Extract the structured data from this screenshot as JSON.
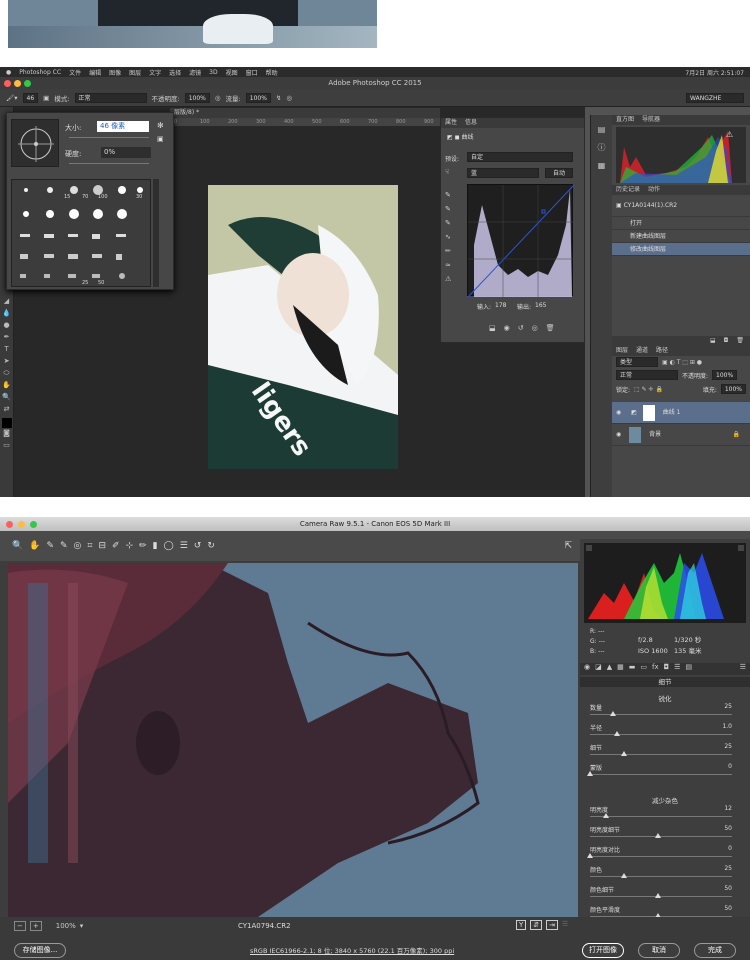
{
  "top_photo": {},
  "mac_menu": [
    "Photoshop CC",
    "文件",
    "编辑",
    "图像",
    "图层",
    "文字",
    "选择",
    "滤镜",
    "3D",
    "视图",
    "窗口",
    "帮助"
  ],
  "mac_status": "7月2日 周六 2:51:07",
  "ps": {
    "title": "Adobe Photoshop CC 2015",
    "options": {
      "brush_size_value": "46",
      "mode_label": "模式:",
      "mode_value": "正常",
      "opacity_label": "不透明度:",
      "opacity_value": "100%",
      "flow_label": "流量:",
      "flow_value": "100%",
      "workspace": "WANGZHE"
    },
    "brush_panel": {
      "size_label": "大小:",
      "size_value": "46 像素",
      "hardness_label": "硬度:",
      "hardness_value": "0%",
      "preset_numbers_row1": [
        "15",
        "70",
        "100",
        "30"
      ],
      "preset_numbers_row2": [
        "25",
        "50"
      ]
    },
    "document_tab": "层版/8) *",
    "ruler_marks": [
      "0",
      "100",
      "200",
      "300",
      "400",
      "500",
      "600",
      "700",
      "800",
      "900"
    ],
    "curves_panel": {
      "tab_properties": "属性",
      "tab_info": "信息",
      "panel_name": "曲线",
      "preset_label": "预设:",
      "preset_value": "自定",
      "channel_value": "蓝",
      "auto_button": "自动",
      "input_label": "输入:",
      "input_value": "178",
      "output_label": "输出:",
      "output_value": "165"
    },
    "histogram_panel": {
      "tab_histogram": "直方图",
      "tab_navigator": "导航器"
    },
    "history_panel": {
      "tab_history": "历史记录",
      "tab_actions": "动作",
      "snapshot": "CY1A0144(1).CR2",
      "items": [
        "打开",
        "新建曲线图层",
        "修改曲线图层"
      ]
    },
    "layers_panel": {
      "tab_layers": "图层",
      "tab_channels": "通道",
      "tab_paths": "路径",
      "filter_kind": "类型",
      "blend_mode": "正常",
      "opacity_label": "不透明度:",
      "opacity_value": "100%",
      "lock_label": "锁定:",
      "fill_label": "填充:",
      "fill_value": "100%",
      "layers": [
        {
          "name": "曲线 1"
        },
        {
          "name": "背景"
        }
      ]
    }
  },
  "camera_raw": {
    "title": "Camera Raw 9.5.1 -  Canon EOS 5D Mark III",
    "rgb": {
      "r_label": "R:",
      "r_value": "---",
      "g_label": "G:",
      "g_value": "---",
      "b_label": "B:",
      "b_value": "---"
    },
    "exif": {
      "aperture": "f/2.8",
      "shutter": "1/320 秒",
      "iso": "ISO 1600",
      "focal": "135 毫米"
    },
    "panel_title": "细节",
    "sharpen_title": "锐化",
    "sharpen": [
      {
        "label": "数量",
        "value": "25",
        "pos": 0.17
      },
      {
        "label": "半径",
        "value": "1.0",
        "pos": 0.2
      },
      {
        "label": "细节",
        "value": "25",
        "pos": 0.25
      },
      {
        "label": "蒙版",
        "value": "0",
        "pos": 0.0
      }
    ],
    "noise_title": "减少杂色",
    "noise": [
      {
        "label": "明亮度",
        "value": "12",
        "pos": 0.12
      },
      {
        "label": "明亮度细节",
        "value": "50",
        "pos": 0.5
      },
      {
        "label": "明亮度对比",
        "value": "0",
        "pos": 0.0
      },
      {
        "label": "颜色",
        "value": "25",
        "pos": 0.25
      },
      {
        "label": "颜色细节",
        "value": "50",
        "pos": 0.5
      },
      {
        "label": "颜色平滑度",
        "value": "50",
        "pos": 0.5
      }
    ],
    "zoom_value": "100%",
    "filename": "CY1A0794.CR2",
    "save_button": "存储图像...",
    "workflow_link": "sRGB IEC61966-2.1; 8 位; 3840 x 5760 (22.1 百万像素); 300 ppi",
    "open_button": "打开图像",
    "cancel_button": "取消",
    "done_button": "完成"
  }
}
